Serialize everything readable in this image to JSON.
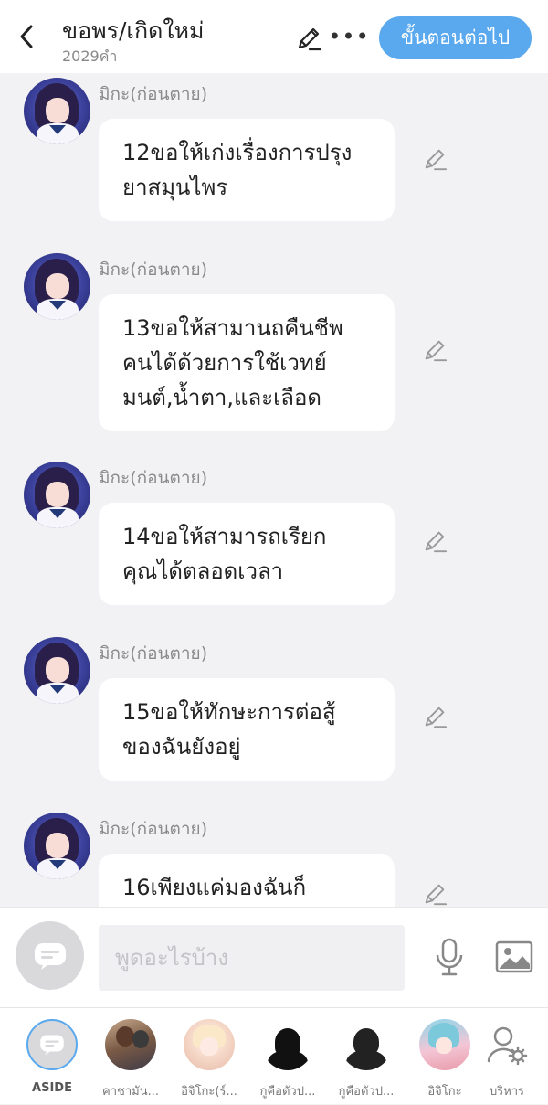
{
  "header": {
    "title": "ขอพร/เกิดใหม่",
    "subtitle": "2029คำ",
    "next_label": "ขั้นตอนต่อไป"
  },
  "messages": [
    {
      "sender": "มิกะ(ก่อนตาย)",
      "lines": [
        "12ขอให้เก่งเรื่องการปรุง",
        "ยาสมุนไพร"
      ]
    },
    {
      "sender": "มิกะ(ก่อนตาย)",
      "lines": [
        "13ขอให้สามานถคืนชีพ",
        "คนได้ด้วยการใช้เวทย์",
        "มนต์,น้ำตา,และเลือด"
      ]
    },
    {
      "sender": "มิกะ(ก่อนตาย)",
      "lines": [
        "14ขอให้สามารถเรียก",
        "คุณได้ตลอดเวลา"
      ]
    },
    {
      "sender": "มิกะ(ก่อนตาย)",
      "lines": [
        "15ขอให้ทักษะการต่อสู้",
        "ของฉันยังอยู่"
      ]
    },
    {
      "sender": "มิกะ(ก่อนตาย)",
      "lines": [
        "16เพียงแค่มองฉันก็",
        ""
      ]
    }
  ],
  "input": {
    "placeholder": "พูดอะไรบ้าง"
  },
  "characters": [
    {
      "label": "ASIDE"
    },
    {
      "label": "คาชามัน..."
    },
    {
      "label": "อิจิโกะ(ร์..."
    },
    {
      "label": "กูคือตัวป..."
    },
    {
      "label": "กูคือตัวป..."
    },
    {
      "label": "อิจิโกะ"
    },
    {
      "label": "บริหาร"
    }
  ],
  "colors": {
    "accent": "#5aa9ee",
    "background": "#f2f2f4"
  }
}
